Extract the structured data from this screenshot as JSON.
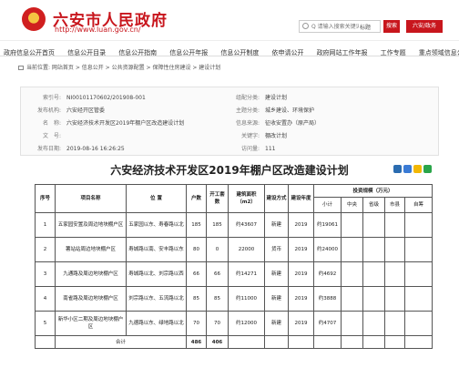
{
  "header": {
    "site_title": "六安市人民政府",
    "site_url": "http://www.luan.gov.cn/",
    "search_placeholder": "Q 请输入搜索关键词",
    "search_scope": "标题",
    "search_button": "搜索",
    "mobile_button": "六安/政务"
  },
  "nav": [
    "政府信息公开首页",
    "信息公开目录",
    "信息公开指南",
    "信息公开年报",
    "信息公开制度",
    "依申请公开",
    "政府网站工作年报",
    "工作专题",
    "重点领域信息公开"
  ],
  "breadcrumb": "当前位置: 网站首页 > 信息公开 > 公共资源配置 > 保障性住房建设 > 建设计划",
  "meta": {
    "index_label": "索引号:",
    "index_value": "NI00101170602/201908-001",
    "dept_label": "发布机构:",
    "dept_value": "六安经开区管委",
    "name_label": "名　称:",
    "name_value": "六安经济技术开发区2019年棚户区改造建设计划",
    "docno_label": "文　号:",
    "docno_value": "",
    "date_label": "发布日期:",
    "date_value": "2019-08-16 16:26:25",
    "cat_label": "组配分类:",
    "cat_value": "建设计划",
    "topic_label": "主题分类:",
    "topic_value": "城乡建设、环境保护",
    "source_label": "信息来源:",
    "source_value": "征收安置办（原产局）",
    "kw_label": "关键字:",
    "kw_value": "棚改计划",
    "visits_label": "访问量:",
    "visits_value": "111"
  },
  "article_title": "六安经济技术开发区2019年棚户区改造建设计划",
  "table": {
    "headers": {
      "seq": "序号",
      "name": "项目名称",
      "location": "位 置",
      "households": "户数",
      "started": "开工套数",
      "area": "建筑面积（m2）",
      "nature": "建设方式",
      "year": "建设年度",
      "invest": "投资规模（万元）",
      "subtotal": "小计",
      "central": "中央",
      "province": "省级",
      "city": "市县",
      "other": "自筹"
    },
    "rows": [
      {
        "seq": "1",
        "name": "五家园安置及周边地块棚户区",
        "location": "五家园以东、寿春路以北",
        "households": "185",
        "started": "185",
        "area": "约43607",
        "nature": "新建",
        "year": "2019",
        "subtotal": "约19061"
      },
      {
        "seq": "2",
        "name": "薯站站周边地块棚户区",
        "location": "寿城路以南、安丰路以东",
        "households": "80",
        "started": "0",
        "area": "22000",
        "nature": "货币",
        "year": "2019",
        "subtotal": "约24000"
      },
      {
        "seq": "3",
        "name": "九通路及周边地块棚户区",
        "location": "寿城路以北、刘宗路以西",
        "households": "66",
        "started": "66",
        "area": "约14271",
        "nature": "新建",
        "year": "2019",
        "subtotal": "约4692"
      },
      {
        "seq": "4",
        "name": "南雀路及周边地块棚户区",
        "location": "刘宗路以东、五流路以北",
        "households": "85",
        "started": "85",
        "area": "约11000",
        "nature": "新建",
        "year": "2019",
        "subtotal": "约3888"
      },
      {
        "seq": "5",
        "name": "新华小区二期及周边地块棚户区",
        "location": "九德路以东、绿地路以北",
        "households": "70",
        "started": "70",
        "area": "约12000",
        "nature": "新建",
        "year": "2019",
        "subtotal": "约4707"
      }
    ],
    "total": {
      "label": "合计",
      "households": "486",
      "started": "406"
    }
  },
  "colors": {
    "brand": "#c8161d",
    "accent_gold": "#f5c542"
  }
}
